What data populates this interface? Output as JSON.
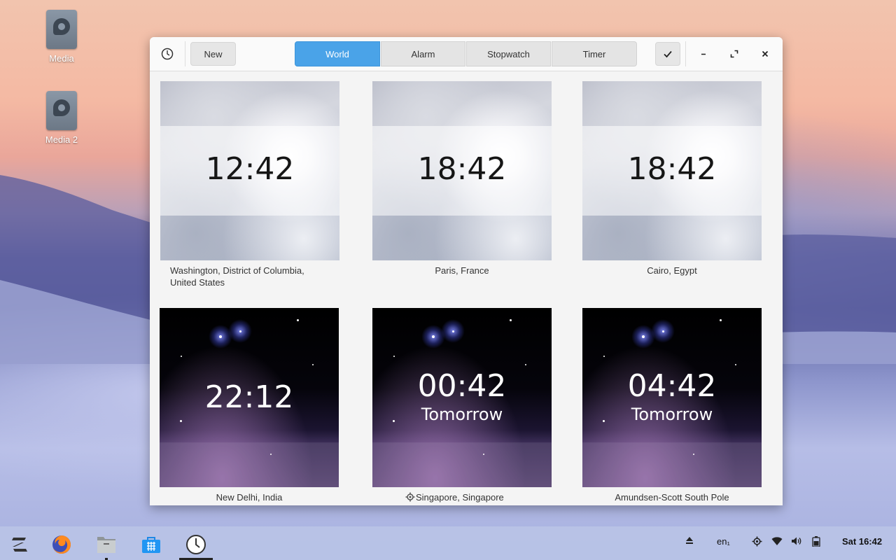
{
  "desktop": {
    "icons": [
      {
        "label": "Media"
      },
      {
        "label": "Media 2"
      }
    ]
  },
  "window": {
    "header": {
      "new_label": "New",
      "tabs": [
        {
          "label": "World",
          "active": true
        },
        {
          "label": "Alarm",
          "active": false
        },
        {
          "label": "Stopwatch",
          "active": false
        },
        {
          "label": "Timer",
          "active": false
        }
      ],
      "select_icon": "check-icon"
    },
    "clocks": [
      {
        "time": "12:42",
        "day": "",
        "city": "Washington, District of Columbia, United States",
        "theme": "day"
      },
      {
        "time": "18:42",
        "day": "",
        "city": "Paris, France",
        "theme": "day"
      },
      {
        "time": "18:42",
        "day": "",
        "city": "Cairo, Egypt",
        "theme": "day"
      },
      {
        "time": "22:12",
        "day": "",
        "city": "New Delhi, India",
        "theme": "night"
      },
      {
        "time": "00:42",
        "day": "Tomorrow",
        "city": "Singapore, Singapore",
        "theme": "night",
        "current_location": true
      },
      {
        "time": "04:42",
        "day": "Tomorrow",
        "city": "Amundsen-Scott South Pole",
        "theme": "night"
      }
    ]
  },
  "taskbar": {
    "apps": [
      "zorin-menu-icon",
      "firefox-icon",
      "files-icon",
      "software-store-icon",
      "clocks-icon"
    ],
    "tray": {
      "keyboard": "en₁",
      "clock": "Sat 16:42"
    }
  }
}
